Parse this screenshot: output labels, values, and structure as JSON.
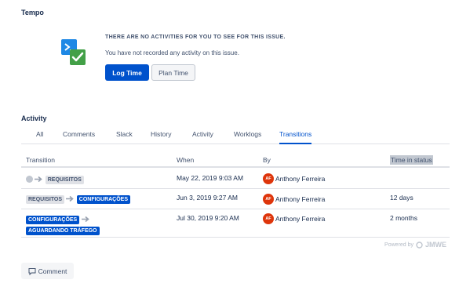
{
  "tempo": {
    "title": "Tempo",
    "empty_heading": "THERE ARE NO ACTIVITIES FOR YOU TO SEE FOR THIS ISSUE.",
    "empty_text": "You have not recorded any activity on this issue.",
    "log_time_label": "Log Time",
    "plan_time_label": "Plan Time",
    "icon": "tempo-logo-icon"
  },
  "activity": {
    "title": "Activity",
    "tabs": [
      "All",
      "Comments",
      "Slack",
      "History",
      "Activity",
      "Worklogs",
      "Transitions"
    ],
    "active_tab": "Transitions",
    "columns": [
      "Transition",
      "When",
      "By",
      "Time in status"
    ],
    "rows": [
      {
        "from": "",
        "to": "REQUISITOS",
        "when": "May 22, 2019 9:03 AM",
        "by_initials": "AF",
        "by": "Anthony Ferreira",
        "time_in_status": ""
      },
      {
        "from": "REQUISITOS",
        "to": "CONFIGURAÇÕES",
        "when": "Jun 3, 2019 9:27 AM",
        "by_initials": "AF",
        "by": "Anthony Ferreira",
        "time_in_status": "12 days"
      },
      {
        "from": "CONFIGURAÇÕES",
        "to": "AGUARDANDO TRÁFEGO",
        "when": "Jul 30, 2019 9:20 AM",
        "by_initials": "AF",
        "by": "Anthony Ferreira",
        "time_in_status": "2 months"
      }
    ],
    "powered_by": "Powered by",
    "powered_brand": "JMWE",
    "comment_label": "Comment"
  },
  "colors": {
    "primary": "#0052cc",
    "avatar": "#de350b",
    "tempo_blue": "#1e88e5",
    "tempo_green": "#43a047"
  }
}
